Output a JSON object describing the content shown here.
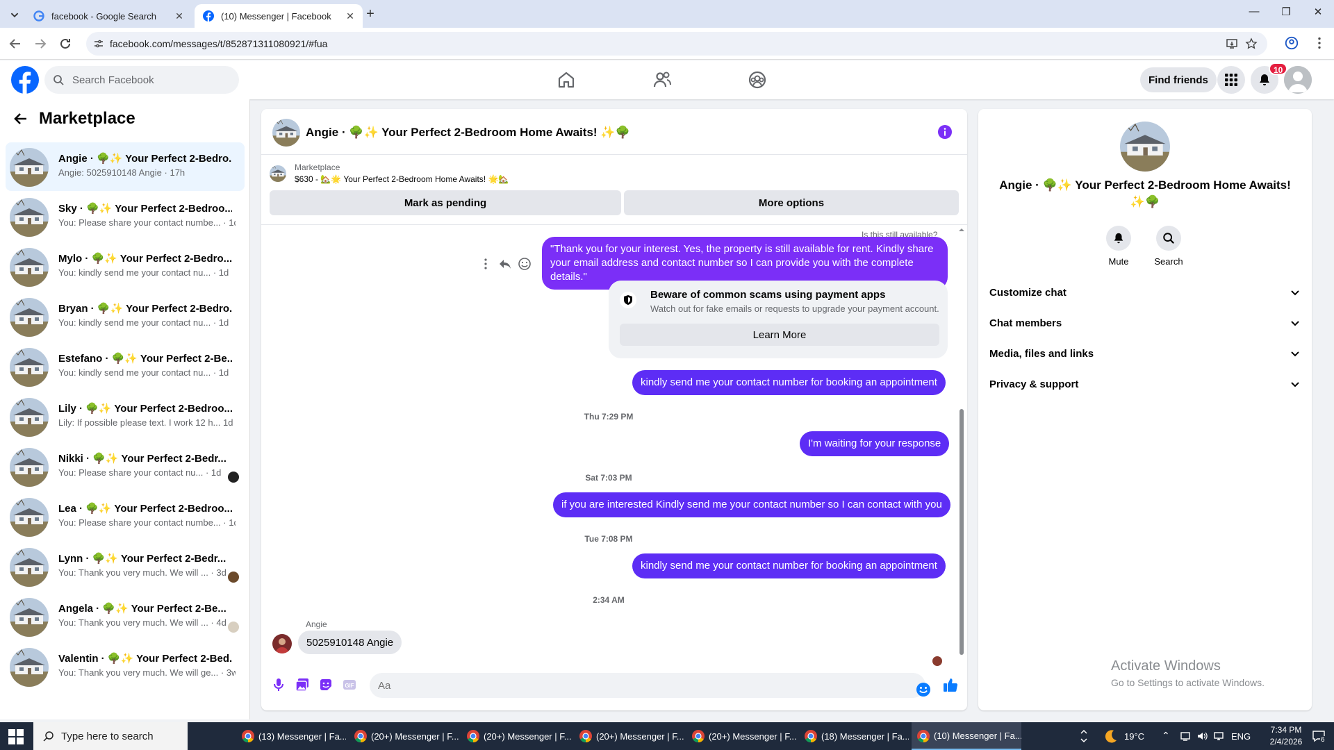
{
  "browser": {
    "tabs": [
      {
        "label": "facebook - Google Search"
      },
      {
        "label": "(10) Messenger | Facebook"
      }
    ],
    "url": "facebook.com/messages/t/852871311080921/#fua"
  },
  "header": {
    "search_placeholder": "Search Facebook",
    "find_friends": "Find friends",
    "notifications_count": "10"
  },
  "left": {
    "title": "Marketplace",
    "chats": [
      {
        "name": "Angie · 🌳✨ Your Perfect 2-Bedro...",
        "preview": "Angie: 5025910148 Angie · 17h",
        "active": true
      },
      {
        "name": "Sky · 🌳✨ Your Perfect 2-Bedroo...",
        "preview": "You: Please share your contact numbe... · 1d"
      },
      {
        "name": "Mylo · 🌳✨ Your Perfect 2-Bedro...",
        "preview": "You: kindly send me your contact nu... · 1d"
      },
      {
        "name": "Bryan · 🌳✨ Your Perfect 2-Bedro...",
        "preview": "You: kindly send me your contact nu... · 1d"
      },
      {
        "name": "Estefano · 🌳✨ Your Perfect 2-Be...",
        "preview": "You: kindly send me your contact nu... · 1d"
      },
      {
        "name": "Lily · 🌳✨ Your Perfect 2-Bedroo...",
        "preview": "Lily: If possible please text. I work 12 h... 1d"
      },
      {
        "name": "Nikki · 🌳✨ Your Perfect 2-Bedr...",
        "preview": "You: Please share your contact nu... · 1d"
      },
      {
        "name": "Lea · 🌳✨ Your Perfect 2-Bedroo...",
        "preview": "You: Please share your contact numbe... · 1d"
      },
      {
        "name": "Lynn · 🌳✨ Your Perfect 2-Bedr...",
        "preview": "You: Thank you very much. We will ... · 3d"
      },
      {
        "name": "Angela · 🌳✨ Your Perfect 2-Be...",
        "preview": "You: Thank you very much. We will ... · 4d"
      },
      {
        "name": "Valentin · 🌳✨ Your Perfect 2-Bed...",
        "preview": "You: Thank you very much. We will ge... · 3w"
      }
    ]
  },
  "conversation": {
    "title": "Angie · 🌳✨ Your Perfect 2-Bedroom Home Awaits! ✨🌳",
    "marketplace_label": "Marketplace",
    "listing": "$630 - 🏡🌟 Your Perfect 2-Bedroom Home Awaits! 🌟🏡",
    "mark_pending": "Mark as pending",
    "more_options": "More options",
    "quoted": "Is this still available?",
    "msg1": "\"Thank you for your interest. Yes, the property is still available for rent. Kindly share your email address and contact number so I can provide you with the complete details.\"",
    "warning_title": "Beware of common scams using payment apps",
    "warning_body": "Watch out for fake emails or requests to upgrade your payment account.",
    "learn_more": "Learn More",
    "msg2": "kindly send me your contact number for booking an appointment",
    "ts1": "Thu 7:29 PM",
    "msg3": "I'm waiting for your response",
    "ts2": "Sat 7:03 PM",
    "msg4": "if you are interested Kindly send me your contact number so I can contact with you",
    "ts3": "Tue 7:08 PM",
    "msg5": "kindly send me your contact number for booking an appointment",
    "ts4": "2:34 AM",
    "incoming_name": "Angie",
    "incoming_msg": "5025910148 Angie",
    "composer_placeholder": "Aa"
  },
  "right": {
    "name": "Angie · 🌳✨ Your Perfect 2-Bedroom Home Awaits! ✨🌳",
    "mute": "Mute",
    "search": "Search",
    "sections": [
      "Customize chat",
      "Chat members",
      "Media, files and links",
      "Privacy & support"
    ]
  },
  "watermark": {
    "line1": "Activate Windows",
    "line2": "Go to Settings to activate Windows."
  },
  "taskbar": {
    "search_placeholder": "Type here to search",
    "apps": [
      "(13) Messenger | Fa...",
      "(20+) Messenger | F...",
      "(20+) Messenger | F...",
      "(20+) Messenger | F...",
      "(20+) Messenger | F...",
      "(18) Messenger | Fa...",
      "(10) Messenger | Fa..."
    ],
    "weather": "19°C",
    "lang": "ENG",
    "time": "7:34 PM",
    "date": "2/4/2026",
    "action_badge": "6"
  },
  "colors": {
    "fb_blue": "#0866ff",
    "messenger_purple": "#7b2ff7",
    "badge_red": "#e41e3f"
  }
}
